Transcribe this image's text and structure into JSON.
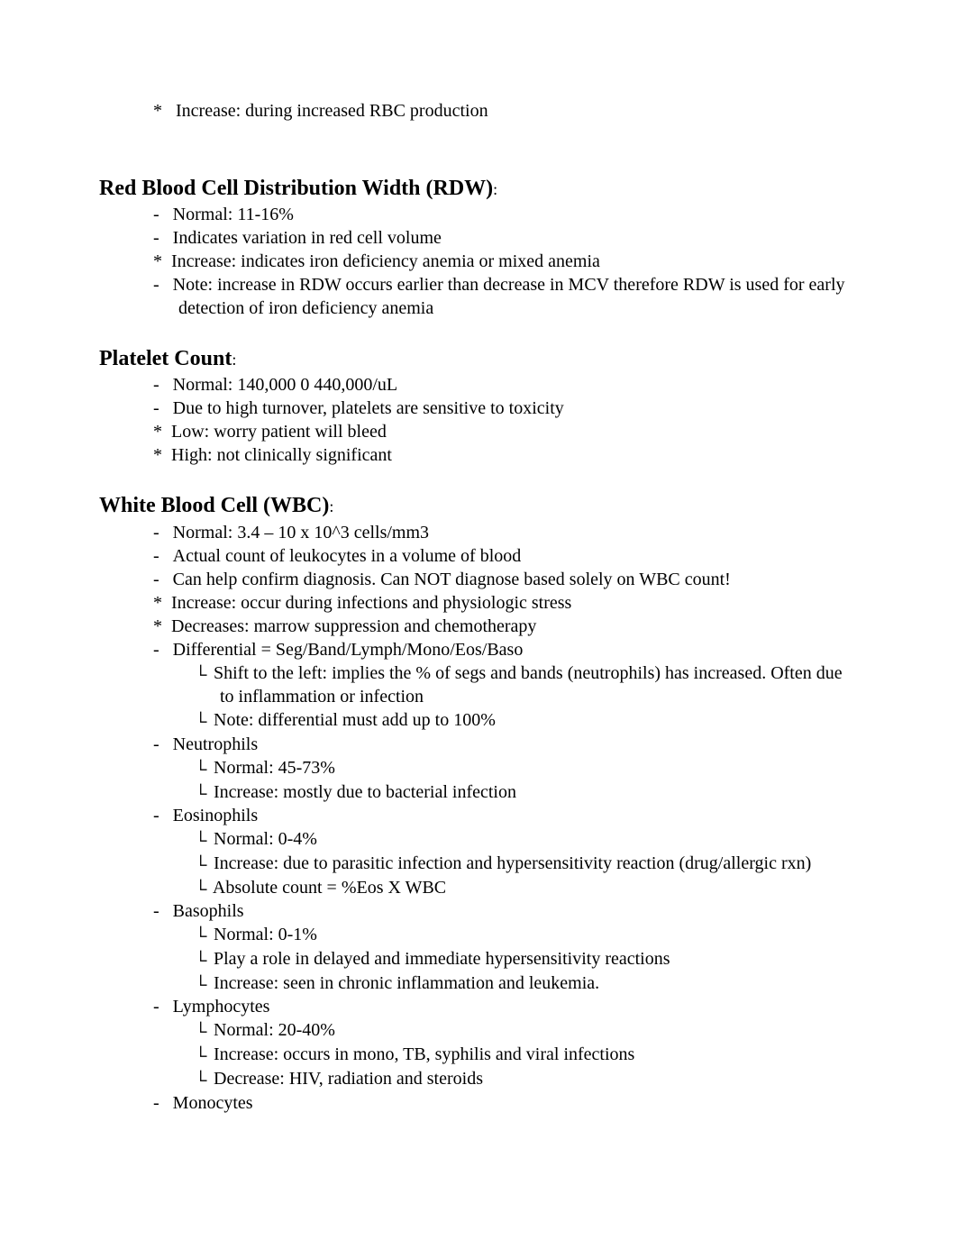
{
  "top_item": {
    "label": "Increase:",
    "text": "during increased RBC production"
  },
  "sections": [
    {
      "heading": "Red Blood Cell Distribution Width (RDW)",
      "items": [
        {
          "marker": "-",
          "text": "Normal: 11-16%"
        },
        {
          "marker": "-",
          "text": "Indicates variation in red cell volume"
        },
        {
          "marker": "*",
          "label": "Increase:",
          "text": "indicates iron deficiency anemia or mixed anemia"
        },
        {
          "marker": "-",
          "text": "Note: increase in RDW occurs earlier than decrease in MCV therefore RDW is used for early detection of iron deficiency anemia"
        }
      ]
    },
    {
      "heading": "Platelet Count",
      "items": [
        {
          "marker": "-",
          "text": "Normal: 140,000 0 440,000/uL"
        },
        {
          "marker": "-",
          "text": "Due to high turnover, platelets are sensitive to toxicity"
        },
        {
          "marker": "*",
          "label": "Low:",
          "text": "worry patient will bleed"
        },
        {
          "marker": "*",
          "label": "High:",
          "text": "not clinically significant"
        }
      ]
    },
    {
      "heading": "White Blood Cell (WBC)",
      "items": [
        {
          "marker": "-",
          "text": "Normal: 3.4 – 10 x 10^3 cells/mm3"
        },
        {
          "marker": "-",
          "text": "Actual count of leukocytes in a volume of blood"
        },
        {
          "marker": "-",
          "text": "Can help confirm diagnosis. Can NOT diagnose based solely on WBC count!"
        },
        {
          "marker": "*",
          "label": "Increase:",
          "text": "occur during infections and physiologic stress"
        },
        {
          "marker": "*",
          "label": "Decreases: ",
          "text": "marrow suppression and chemotherapy"
        },
        {
          "marker": "-",
          "text": "Differential = Seg/Band/Lymph/Mono/Eos/Baso",
          "children": [
            {
              "text": "Shift to the left: implies the % of segs and bands (neutrophils) has increased. Often due to inflammation or infection"
            },
            {
              "text": "Note: differential must add up to 100%"
            }
          ]
        },
        {
          "marker": "-",
          "text": "Neutrophils",
          "children": [
            {
              "text": "Normal: 45-73%"
            },
            {
              "text": "Increase: mostly due to bacterial infection"
            }
          ]
        },
        {
          "marker": "-",
          "text": "Eosinophils",
          "children": [
            {
              "text": "Normal: 0-4%"
            },
            {
              "text": "Increase: due to parasitic infection and hypersensitivity reaction (drug/allergic rxn)"
            },
            {
              "text": "Absolute count = %Eos X WBC"
            }
          ]
        },
        {
          "marker": "-",
          "text": "Basophils",
          "children": [
            {
              "text": "Normal: 0-1%"
            },
            {
              "text": "Play a role in delayed and immediate hypersensitivity reactions"
            },
            {
              "text": "Increase: seen in chronic inflammation and leukemia."
            }
          ]
        },
        {
          "marker": "-",
          "text": "Lymphocytes",
          "children": [
            {
              "text": "Normal: 20-40%"
            },
            {
              "text": "Increase: occurs in mono, TB, syphilis and viral infections"
            },
            {
              "text": "Decrease: HIV, radiation and steroids"
            }
          ]
        },
        {
          "marker": "-",
          "text": "Monocytes"
        }
      ]
    }
  ],
  "submarker": "└",
  "colon": ":"
}
